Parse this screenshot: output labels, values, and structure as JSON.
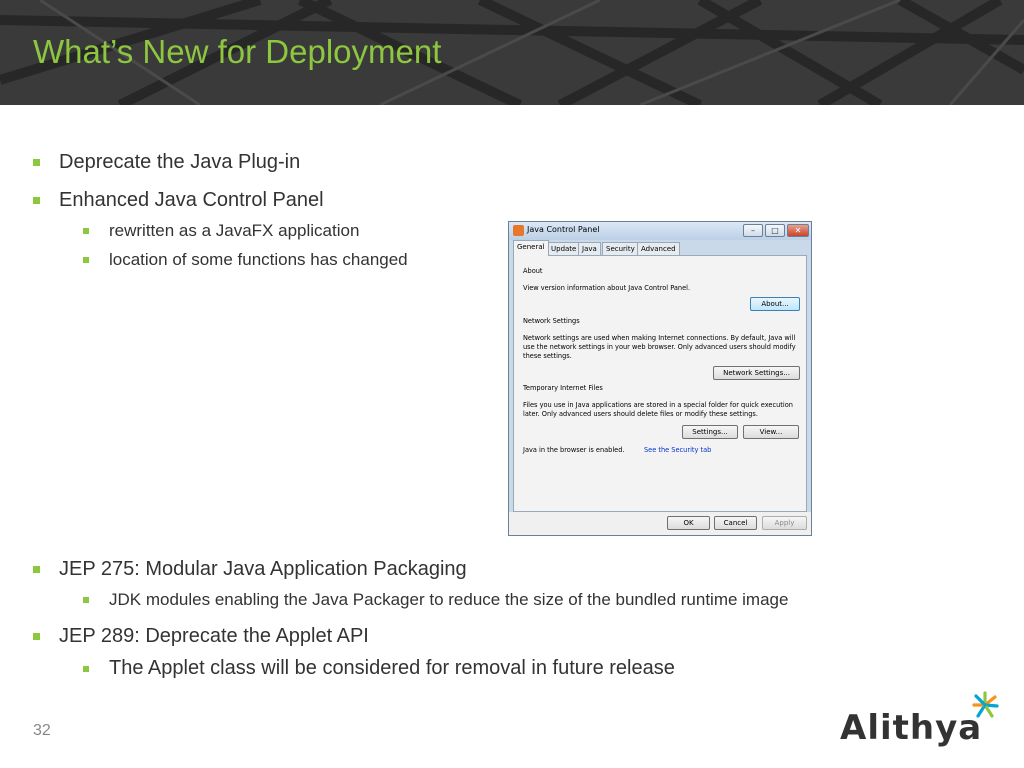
{
  "slide": {
    "title": "What’s New for Deployment",
    "page_number": "32"
  },
  "bullets": {
    "b1": "Deprecate the Java Plug-in",
    "b2": "Enhanced Java Control Panel",
    "b2_1": "rewritten as a JavaFX application",
    "b2_2": "location of some functions has changed",
    "b3": "JEP 275: Modular Java Application Packaging",
    "b3_1": "JDK modules enabling the Java Packager to reduce the size of the bundled runtime image",
    "b4": "JEP 289: Deprecate the Applet API",
    "b4_1": "The Applet class will be considered for removal in future release"
  },
  "window": {
    "title": "Java Control Panel",
    "controls": {
      "minimize": "–",
      "maximize": "□",
      "close": "✕"
    },
    "tabs": [
      "General",
      "Update",
      "Java",
      "Security",
      "Advanced"
    ],
    "active_tab": "General",
    "about_heading": "About",
    "about_text": "View version information about Java Control Panel.",
    "about_button": "About...",
    "network_heading": "Network Settings",
    "network_text": "Network settings are used when making Internet connections. By default, Java will use the network settings in your web browser. Only advanced users should modify these settings.",
    "network_button": "Network Settings...",
    "temp_heading": "Temporary Internet Files",
    "temp_text": "Files you use in Java applications are stored in a special folder for quick execution later. Only advanced users should delete files or modify these settings.",
    "settings_button": "Settings...",
    "view_button": "View...",
    "browser_status": "Java in the browser is enabled.",
    "security_link": "See the Security tab",
    "ok_button": "OK",
    "cancel_button": "Cancel",
    "apply_button": "Apply"
  },
  "logo": {
    "text": "Alithya"
  },
  "colors": {
    "accent": "#8dc63f",
    "header_bg": "#3a3a3a",
    "text": "#333333"
  },
  "icons": {
    "app_icon": "java-cup-icon",
    "logo_mark": "alithya-star-icon"
  }
}
